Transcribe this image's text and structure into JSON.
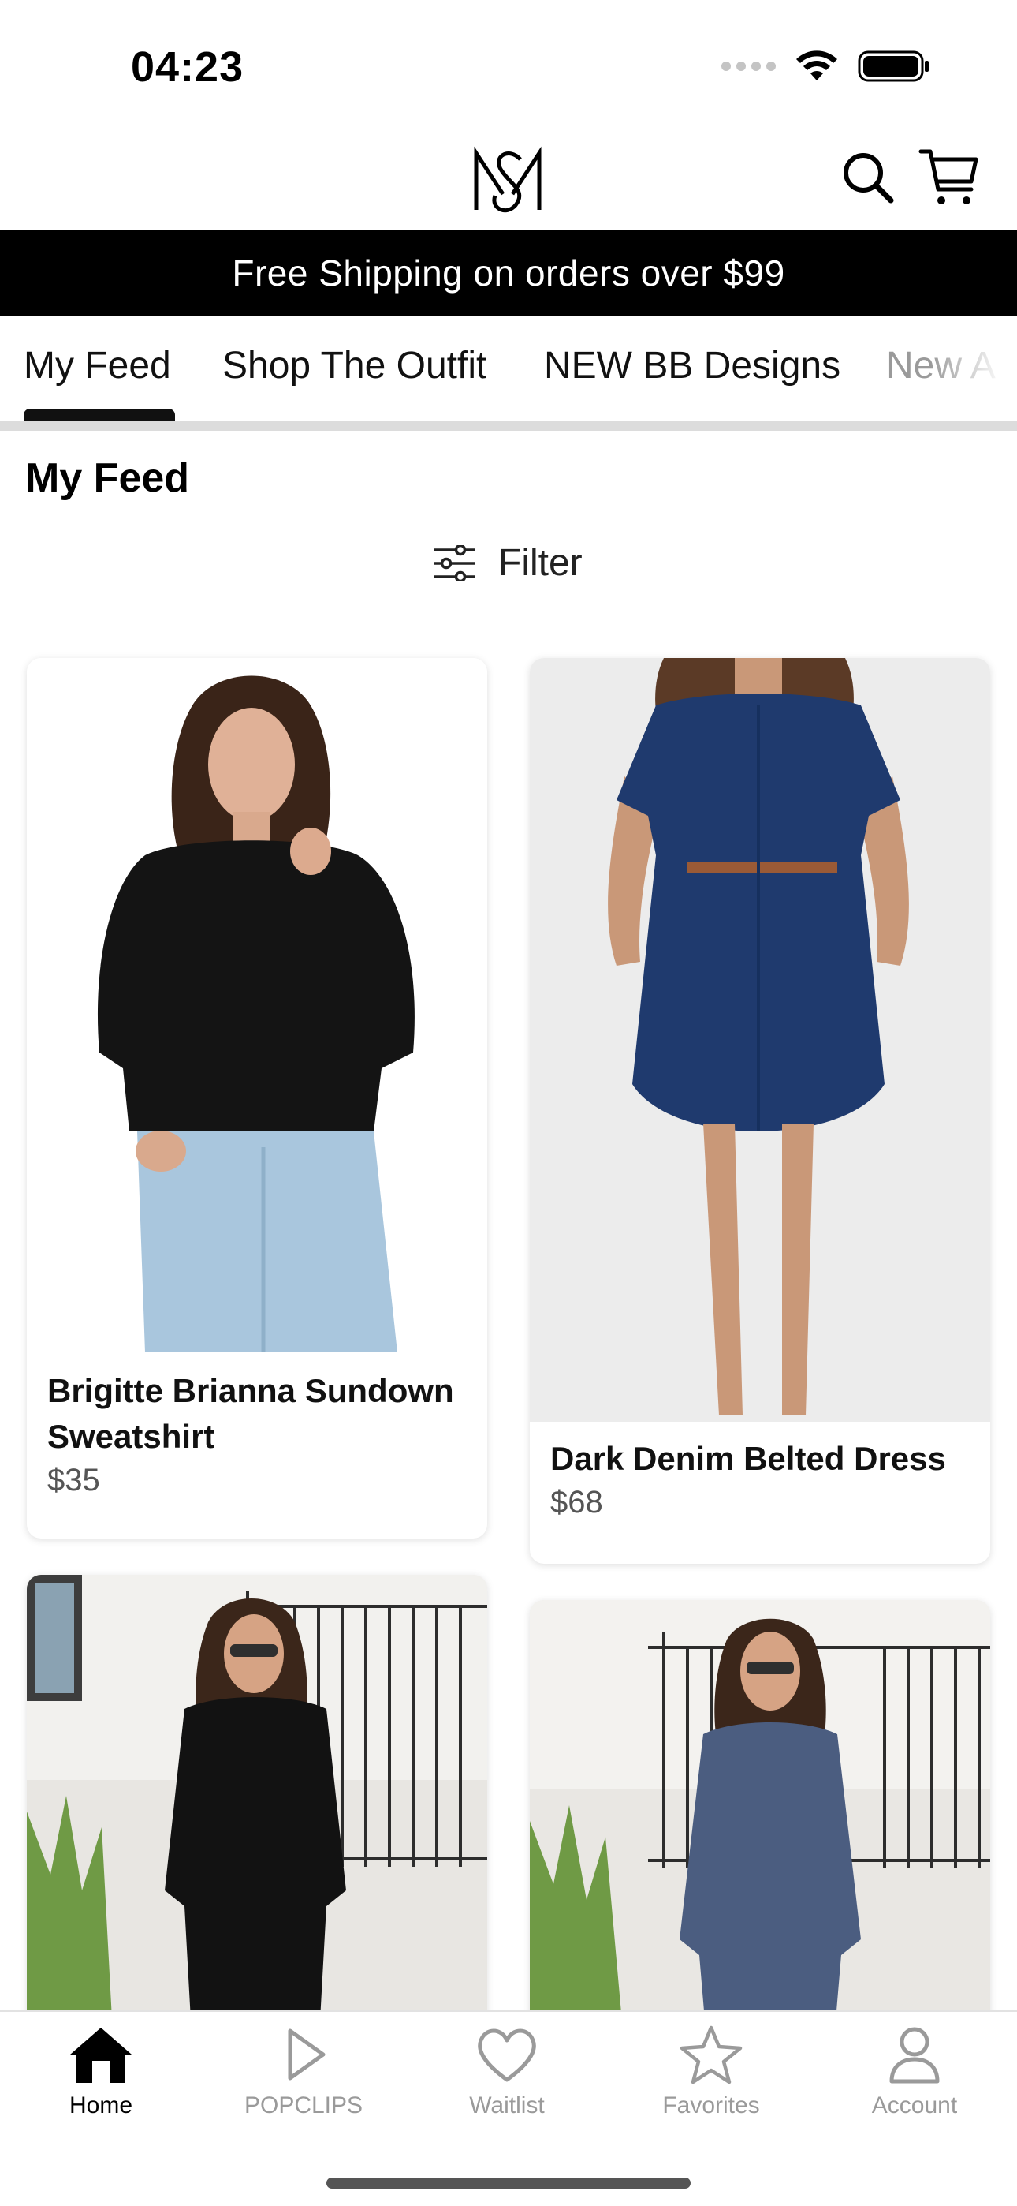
{
  "status_bar": {
    "time": "04:23",
    "icons": [
      "signal-dots-icon",
      "wifi-icon",
      "battery-icon"
    ]
  },
  "header": {
    "logo": "MS monogram",
    "icons": [
      "search-icon",
      "cart-icon"
    ]
  },
  "banner": {
    "text": "Free Shipping on orders over $99"
  },
  "tabs": [
    {
      "label": "My Feed",
      "active": true
    },
    {
      "label": "Shop The Outfit",
      "active": false
    },
    {
      "label": "NEW BB Designs",
      "active": false
    },
    {
      "label": "New A",
      "active": false
    }
  ],
  "feed": {
    "title": "My Feed",
    "filter_label": "Filter",
    "filter_icon": "sliders-icon"
  },
  "products": [
    {
      "name": "Brigitte Brianna Sundown Sweatshirt",
      "price": "$35"
    },
    {
      "name": "Dark Denim Belted Dress",
      "price": "$68"
    },
    {
      "name": "",
      "price": ""
    },
    {
      "name": "",
      "price": ""
    }
  ],
  "bottom_nav": [
    {
      "label": "Home",
      "icon": "home-icon",
      "active": true
    },
    {
      "label": "POPCLIPS",
      "icon": "play-icon",
      "active": false
    },
    {
      "label": "Waitlist",
      "icon": "heart-icon",
      "active": false
    },
    {
      "label": "Favorites",
      "icon": "star-icon",
      "active": false
    },
    {
      "label": "Account",
      "icon": "person-icon",
      "active": false
    }
  ],
  "colors": {
    "banner_bg": "#000000",
    "active_text": "#000000",
    "inactive_text": "#9a9a9a",
    "tab_underline": "#111111"
  }
}
